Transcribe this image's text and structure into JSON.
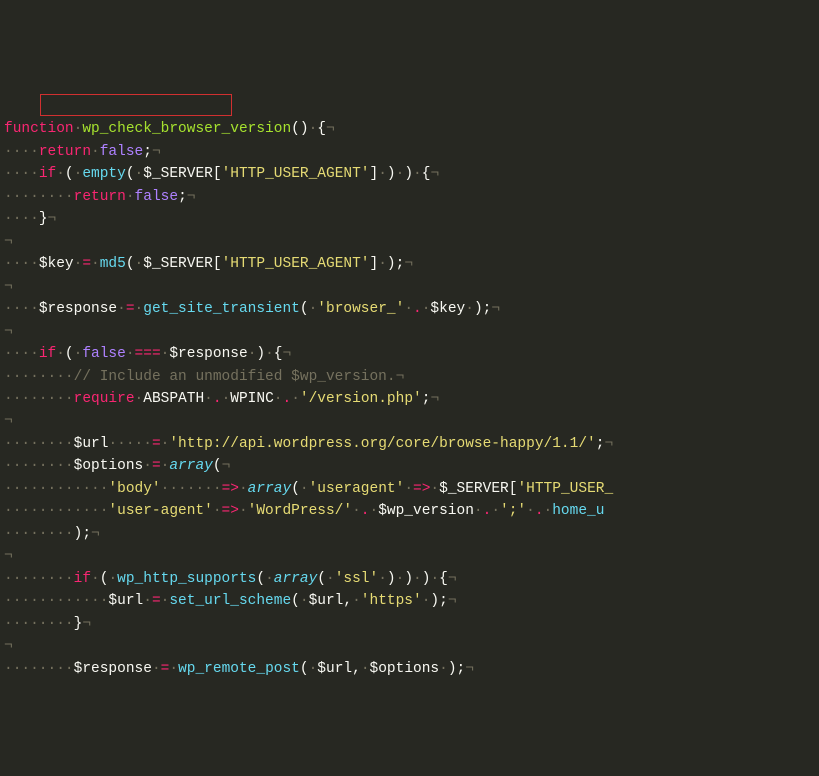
{
  "code": {
    "fn_name": "wp_check_browser_version",
    "ret_false1": {
      "ret": "return",
      "false": "false"
    },
    "if_empty": {
      "if": "if",
      "empty": "empty",
      "server": "$_SERVER",
      "key": "'HTTP_USER_AGENT'"
    },
    "ret_false2": {
      "ret": "return",
      "false": "false"
    },
    "key_line": {
      "var": "$key",
      "md5": "md5",
      "server": "$_SERVER",
      "key": "'HTTP_USER_AGENT'"
    },
    "resp_line": {
      "var": "$response",
      "fn": "get_site_transient",
      "str": "'browser_'",
      "key": "$key"
    },
    "if_false": {
      "if": "if",
      "false": "false",
      "op": "===",
      "resp": "$response"
    },
    "comment": "// Include an unmodified $wp_version.",
    "require": {
      "req": "require",
      "abs": "ABSPATH",
      "wpinc": "WPINC",
      "str": "'/version.php'"
    },
    "url_line": {
      "var": "$url",
      "str": "'http://api.wordpress.org/core/browse-happy/1.1/'"
    },
    "options": {
      "var": "$options",
      "arr": "array"
    },
    "body_line": {
      "k": "'body'",
      "arr": "array",
      "ua": "'useragent'",
      "server": "$_SERVER",
      "key": "'HTTP_USER_"
    },
    "ua_line": {
      "k": "'user-agent'",
      "wp": "'WordPress/'",
      "var": "$wp_version",
      "semi": "';'",
      "home": "home_u"
    },
    "supports": {
      "if": "if",
      "fn": "wp_http_supports",
      "arr": "array",
      "ssl": "'ssl'"
    },
    "scheme": {
      "var": "$url",
      "fn": "set_url_scheme",
      "url": "$url",
      "https": "'https'"
    },
    "remote": {
      "var": "$response",
      "fn": "wp_remote_post",
      "url": "$url",
      "opts": "$options"
    }
  },
  "ws": {
    "dot": "·",
    "pil": "¬"
  }
}
